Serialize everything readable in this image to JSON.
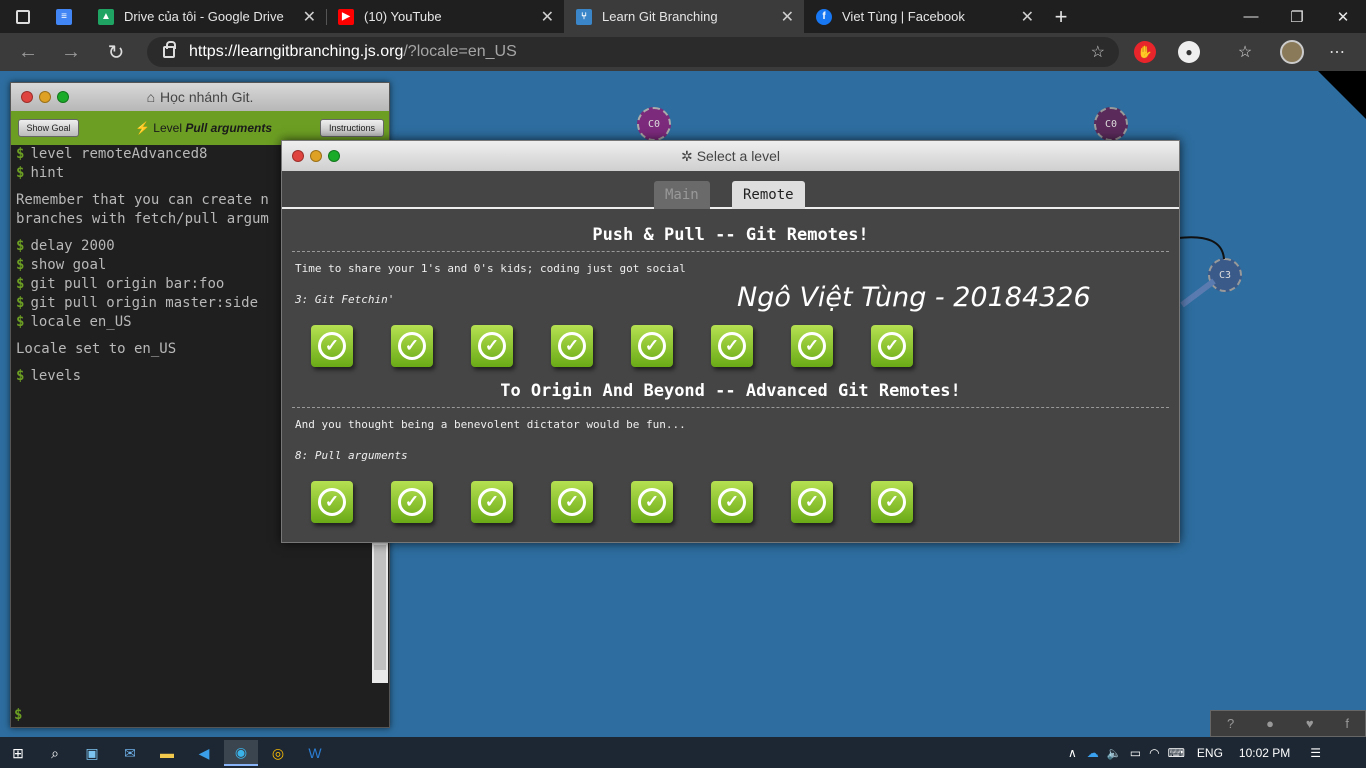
{
  "browser": {
    "tabs": [
      {
        "title": "Drive của tôi - Google Drive",
        "icon": "google-drive-icon",
        "color": "#1fa463"
      },
      {
        "title": "(10) YouTube",
        "icon": "youtube-icon",
        "color": "#ff0000"
      },
      {
        "title": "Learn Git Branching",
        "icon": "git-branch-icon",
        "color": "#3a86c8",
        "active": true
      },
      {
        "title": "Viet Tùng | Facebook",
        "icon": "facebook-icon",
        "color": "#1877f2"
      }
    ],
    "url_host": "https://learngitbranching.js.org",
    "url_path": "/?locale=en_US"
  },
  "terminal": {
    "title": "Học nhánh Git.",
    "show_goal": "Show Goal",
    "instructions": "Instructions",
    "level_prefix": "Level",
    "level_name": "Pull arguments",
    "lines": [
      {
        "prompt": true,
        "text": "level remoteAdvanced8"
      },
      {
        "prompt": true,
        "text": "hint"
      },
      {
        "gap": true
      },
      {
        "prompt": false,
        "text": "Remember that you can create n"
      },
      {
        "prompt": false,
        "text": "branches with fetch/pull argum"
      },
      {
        "gap": true
      },
      {
        "prompt": true,
        "text": "delay 2000"
      },
      {
        "prompt": true,
        "text": "show goal"
      },
      {
        "prompt": true,
        "text": "git pull origin bar:foo"
      },
      {
        "prompt": true,
        "text": "git pull origin master:side"
      },
      {
        "prompt": true,
        "text": "locale en_US"
      },
      {
        "gap": true
      },
      {
        "prompt": false,
        "text": "Locale set to en_US"
      },
      {
        "gap": true
      },
      {
        "prompt": true,
        "text": "levels"
      }
    ],
    "prompt_symbol": "$"
  },
  "graph": {
    "nodes": [
      {
        "label": "C0",
        "color": "#7c2a7c"
      },
      {
        "label": "C0",
        "color": "#5a2a5a"
      },
      {
        "label": "C3",
        "color": "#3a5a8a"
      }
    ]
  },
  "modal": {
    "title": "Select a level",
    "tabs": [
      {
        "label": "Main",
        "active": false
      },
      {
        "label": "Remote",
        "active": true
      }
    ],
    "sections": [
      {
        "title": "Push & Pull -- Git Remotes!",
        "description": "Time to share your 1's and 0's kids; coding just got social",
        "current_level": "3: Git Fetchin'",
        "levels_completed": 8
      },
      {
        "title": "To Origin And Beyond -- Advanced Git Remotes!",
        "description": "And you thought being a benevolent dictator would be fun...",
        "current_level": "8: Pull arguments",
        "levels_completed": 8
      }
    ]
  },
  "watermark": "Ngô Việt Tùng - 20184326",
  "taskbar": {
    "language": "ENG",
    "time": "10:02 PM"
  }
}
